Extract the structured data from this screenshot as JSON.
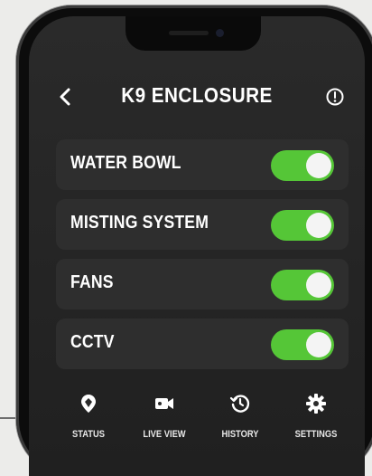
{
  "header": {
    "title": "K9 ENCLOSURE",
    "back_icon": "chevron-left-icon",
    "info_icon": "info-icon"
  },
  "controls": [
    {
      "label": "WATER BOWL",
      "on": true
    },
    {
      "label": "MISTING SYSTEM",
      "on": true
    },
    {
      "label": "FANS",
      "on": true
    },
    {
      "label": "CCTV",
      "on": true
    }
  ],
  "tabs": [
    {
      "label": "STATUS",
      "icon": "status-icon"
    },
    {
      "label": "LIVE VIEW",
      "icon": "video-camera-icon"
    },
    {
      "label": "HISTORY",
      "icon": "history-icon"
    },
    {
      "label": "SETTINGS",
      "icon": "gear-icon"
    }
  ],
  "colors": {
    "toggle_on": "#55c637",
    "background": "#232323",
    "row": "#2e2e2e"
  }
}
